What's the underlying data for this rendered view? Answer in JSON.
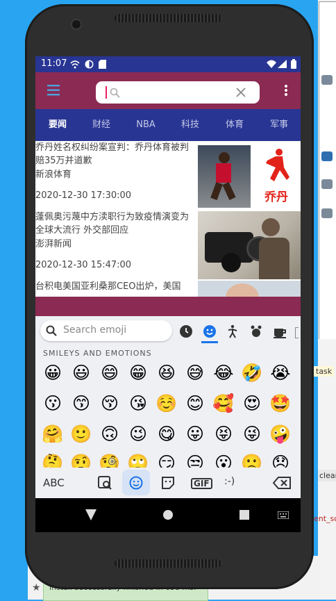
{
  "status": {
    "time": "11:07"
  },
  "search": {
    "placeholder": ""
  },
  "tabs": [
    "要闻",
    "财经",
    "NBA",
    "科技",
    "体育",
    "军事"
  ],
  "news": [
    {
      "title": "乔丹姓名权纠纷案宣判：乔丹体育被判赔35万并道歉",
      "source": "新浪体育",
      "time": "2020-12-30 17:30:00",
      "logo_text": "乔丹"
    },
    {
      "title": "蓬佩奥污蔑中方渎职行为致疫情演变为全球大流行 外交部回应",
      "source": "澎湃新闻",
      "time": "2020-12-30 15:47:00"
    },
    {
      "title": "台积电美国亚利桑那CEO出炉，美国",
      "source": "",
      "time": ""
    }
  ],
  "keyboard": {
    "search_placeholder": "Search emoji",
    "section_title": "SMILEYS AND EMOTIONS",
    "emoji_rows": [
      [
        "😀",
        "😃",
        "😄",
        "😁",
        "😆",
        "😅",
        "😂",
        "🤣",
        "😭"
      ],
      [
        "😗",
        "😙",
        "😚",
        "😘",
        "☺️",
        "😊",
        "🥰",
        "😍",
        "🤩"
      ],
      [
        "🤗",
        "🙂",
        "🙃",
        "😉",
        "😋",
        "😛",
        "😝",
        "😜",
        "🤪"
      ],
      [
        "🤔",
        "🤨",
        "🧐",
        "🙄",
        "😏",
        "😒",
        "😮",
        "🙁",
        "😞"
      ]
    ],
    "abc_label": "ABC",
    "gif_label": "GIF",
    "emoticon_label": ":-)"
  },
  "ide": {
    "task": "task",
    "clean": "clean",
    "event": "ent_so",
    "install_msg": "Install successfully finished in 658 ms."
  },
  "colors": {
    "statusbar": "#283593",
    "appbar": "#8b2a52",
    "accent": "#1a73e8"
  }
}
